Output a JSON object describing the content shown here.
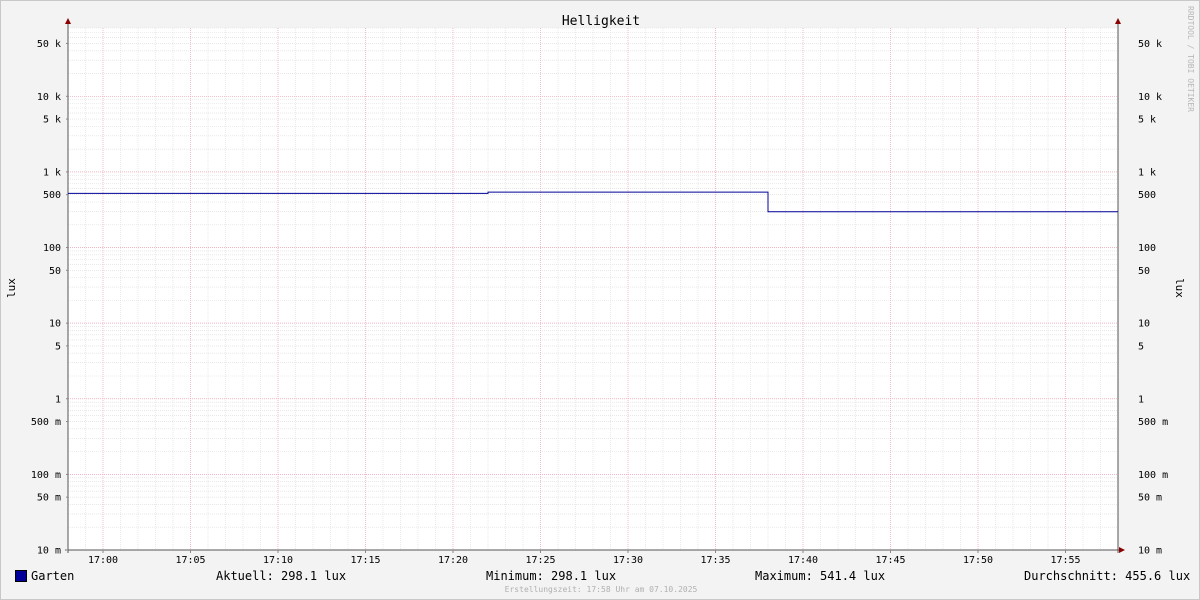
{
  "chart_data": {
    "type": "line",
    "title": "Helligkeit",
    "ylabel_left": "lux",
    "ylabel_right": "lux",
    "yscale": "log",
    "ylim": [
      0.01,
      80000
    ],
    "xlim": [
      "16:58",
      "17:58"
    ],
    "grid": true,
    "y_ticks": [
      {
        "v": 50000,
        "label": "50 k"
      },
      {
        "v": 10000,
        "label": "10 k"
      },
      {
        "v": 5000,
        "label": "5 k"
      },
      {
        "v": 1000,
        "label": "1 k"
      },
      {
        "v": 500,
        "label": "500"
      },
      {
        "v": 100,
        "label": "100"
      },
      {
        "v": 50,
        "label": "50"
      },
      {
        "v": 10,
        "label": "10"
      },
      {
        "v": 5,
        "label": "5"
      },
      {
        "v": 1,
        "label": "1"
      },
      {
        "v": 0.5,
        "label": "500 m"
      },
      {
        "v": 0.1,
        "label": "100 m"
      },
      {
        "v": 0.05,
        "label": "50 m"
      },
      {
        "v": 0.01,
        "label": "10 m"
      }
    ],
    "x_ticks": [
      "17:00",
      "17:05",
      "17:10",
      "17:15",
      "17:20",
      "17:25",
      "17:30",
      "17:35",
      "17:40",
      "17:45",
      "17:50",
      "17:55"
    ],
    "series": [
      {
        "name": "Garten",
        "color": "#000099",
        "x": [
          "16:58",
          "17:22",
          "17:22",
          "17:38",
          "17:38",
          "17:58"
        ],
        "values": [
          520,
          520,
          541.4,
          541.4,
          298.1,
          298.1
        ]
      }
    ]
  },
  "legend": {
    "series_name": "Garten",
    "swatch_color": "#000099",
    "current": "Aktuell: 298.1 lux",
    "minimum": "Minimum: 298.1 lux",
    "maximum": "Maximum: 541.4 lux",
    "average": "Durchschnitt: 455.6 lux"
  },
  "watermark": "RRDTOOL / TOBI OETIKER",
  "footer": "Erstellungszeit: 17:58 Uhr am 07.10.2025"
}
